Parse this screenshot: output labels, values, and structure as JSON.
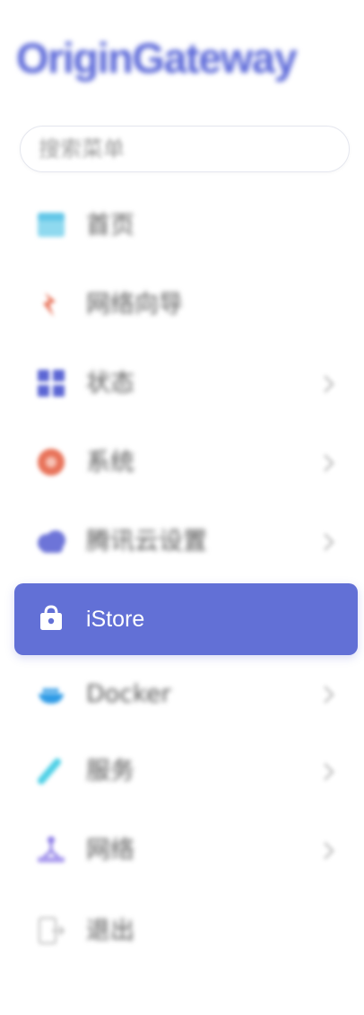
{
  "app": {
    "logo_text": "OriginGateway"
  },
  "search": {
    "placeholder": "搜索菜单"
  },
  "menu": {
    "items": [
      {
        "label": "首页",
        "icon": "home-icon",
        "has_submenu": false,
        "active": false,
        "color": "#63c7e8"
      },
      {
        "label": "网络向导",
        "icon": "wizard-icon",
        "has_submenu": false,
        "active": false,
        "color": "#e8735a"
      },
      {
        "label": "状态",
        "icon": "status-grid-icon",
        "has_submenu": true,
        "active": false,
        "color": "#5c66d4"
      },
      {
        "label": "系统",
        "icon": "system-gear-icon",
        "has_submenu": true,
        "active": false,
        "color": "#e8735a"
      },
      {
        "label": "腾讯云设置",
        "icon": "cloud-icon",
        "has_submenu": true,
        "active": false,
        "color": "#6d74d8"
      },
      {
        "label": "iStore",
        "icon": "shopping-bag-icon",
        "has_submenu": false,
        "active": true,
        "color": "#ffffff"
      },
      {
        "label": "Docker",
        "icon": "docker-icon",
        "has_submenu": true,
        "active": false,
        "color": "#2f9be6"
      },
      {
        "label": "服务",
        "icon": "services-icon",
        "has_submenu": true,
        "active": false,
        "color": "#4fd0e6"
      },
      {
        "label": "网络",
        "icon": "network-icon",
        "has_submenu": true,
        "active": false,
        "color": "#8b7be6"
      },
      {
        "label": "退出",
        "icon": "logout-icon",
        "has_submenu": false,
        "active": false,
        "color": "#b8b8b8"
      }
    ]
  },
  "colors": {
    "accent": "#6270d6",
    "logo": "#5a67d8"
  }
}
